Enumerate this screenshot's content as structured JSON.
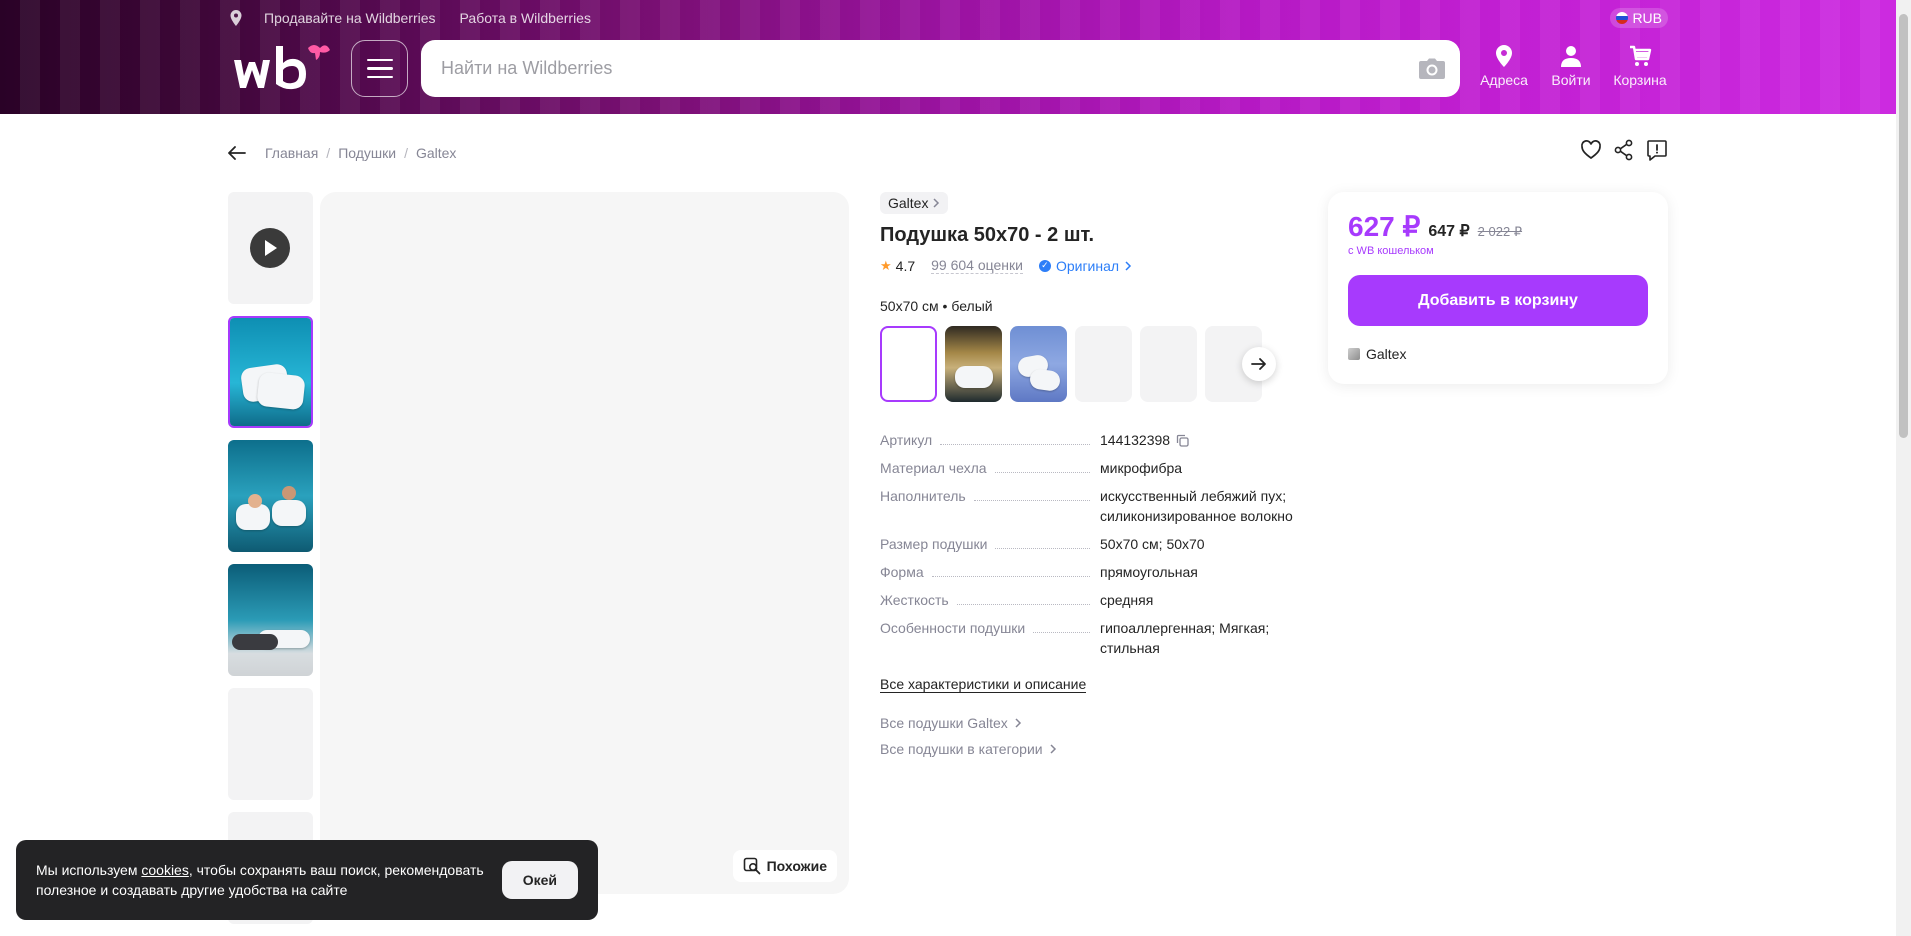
{
  "header": {
    "sell_link": "Продавайте на Wildberries",
    "job_link": "Работа в Wildberries",
    "currency": "RUB",
    "search_placeholder": "Найти на Wildberries",
    "addresses_label": "Адреса",
    "login_label": "Войти",
    "cart_label": "Корзина",
    "brand_color": "#a73afd"
  },
  "breadcrumbs": [
    "Главная",
    "Подушки",
    "Galtex"
  ],
  "product": {
    "brand": "Galtex",
    "title": "Подушка 50x70 - 2 шт.",
    "rating": "4.7",
    "reviews": "99 604 оценки",
    "original": "Оригинал",
    "variant": "50x70 см • белый",
    "specs": [
      {
        "name": "Артикул",
        "value": "144132398"
      },
      {
        "name": "Материал чехла",
        "value": "микрофибра"
      },
      {
        "name": "Наполнитель",
        "value": "искусственный лебяжий пух; силиконизированное волокно"
      },
      {
        "name": "Размер подушки",
        "value": "50x70 см; 50x70"
      },
      {
        "name": "Форма",
        "value": "прямоугольная"
      },
      {
        "name": "Жесткость",
        "value": "средняя"
      },
      {
        "name": "Особенности подушки",
        "value": "гипоаллергенная; Мягкая; стильная"
      }
    ],
    "all_specs_link": "Все характеристики и описание",
    "brand_link": "Все подушки Galtex",
    "category_link": "Все подушки в категории",
    "similar_button": "Похожие"
  },
  "price_card": {
    "price": "627 ₽",
    "price_mid": "647 ₽",
    "price_old": "2 022 ₽",
    "wallet_note": "с WB кошельком",
    "add_to_cart": "Добавить в корзину",
    "seller": "Galtex"
  },
  "cookie": {
    "text_before": "Мы используем ",
    "link": "cookies",
    "text_after": ", чтобы сохранять ваш поиск, рекомендовать полезное и создавать другие удобства на сайте",
    "ok": "Окей"
  }
}
